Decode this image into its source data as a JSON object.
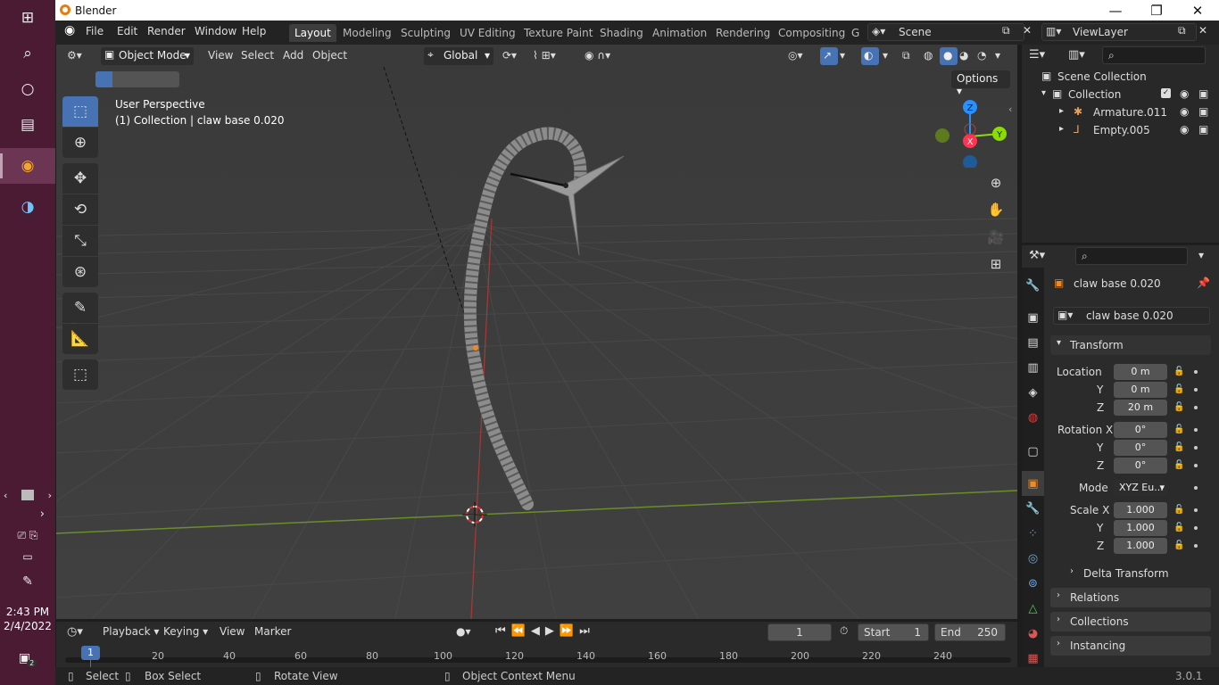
{
  "window": {
    "title": "Blender"
  },
  "taskbar": {
    "clock_time": "2:43 PM",
    "clock_date": "2/4/2022",
    "notification_count": "2"
  },
  "menubar": {
    "items": [
      "File",
      "Edit",
      "Render",
      "Window",
      "Help"
    ]
  },
  "workspaces": [
    "Layout",
    "Modeling",
    "Sculpting",
    "UV Editing",
    "Texture Paint",
    "Shading",
    "Animation",
    "Rendering",
    "Compositing",
    "G"
  ],
  "active_workspace": "Layout",
  "scene": {
    "name": "Scene",
    "view_layer": "ViewLayer"
  },
  "viewport_header": {
    "mode": "Object Mode",
    "menus": [
      "View",
      "Select",
      "Add",
      "Object"
    ],
    "transform_orientation": "Global",
    "options_label": "Options"
  },
  "viewport": {
    "perspective": "User Perspective",
    "object_info": "(1) Collection | claw base 0.020"
  },
  "gizmo": {
    "z": "Z",
    "x": "X",
    "y": "Y"
  },
  "outliner": {
    "root": "Scene Collection",
    "collection": "Collection",
    "objects": [
      "Armature.011",
      "Empty.005"
    ]
  },
  "properties": {
    "object_name": "claw base 0.020",
    "data_name": "claw base 0.020",
    "transform_header": "Transform",
    "location_label": "Location",
    "location": {
      "x": "0 m",
      "y": "0 m",
      "z": "20 m"
    },
    "rotation_label": "Rotation X",
    "rotation": {
      "x": "0°",
      "y": "0°",
      "z": "0°"
    },
    "mode_label": "Mode",
    "mode_value": "XYZ Eu...",
    "scale_label": "Scale X",
    "scale": {
      "x": "1.000",
      "y": "1.000",
      "z": "1.000"
    },
    "axis_y": "Y",
    "axis_z": "Z",
    "delta_transform": "Delta Transform",
    "relations": "Relations",
    "collections": "Collections",
    "instancing": "Instancing"
  },
  "timeline": {
    "menus": [
      "Playback",
      "Keying",
      "View",
      "Marker"
    ],
    "current_frame": "1",
    "start_label": "Start",
    "start": "1",
    "end_label": "End",
    "end": "250",
    "ruler_current": "1",
    "ruler": [
      "20",
      "40",
      "60",
      "80",
      "100",
      "120",
      "140",
      "160",
      "180",
      "200",
      "220",
      "240"
    ]
  },
  "statusbar": {
    "select": "Select",
    "box_select": "Box Select",
    "rotate_view": "Rotate View",
    "context_menu": "Object Context Menu",
    "version": "3.0.1"
  },
  "colors": {
    "accent_blue": "#4772b3",
    "viewport_bg": "#3d3d3d",
    "x_axis": "#ff3352",
    "y_axis": "#8bdc00",
    "z_axis": "#2890ff",
    "taskbar": "#4a1b33"
  }
}
